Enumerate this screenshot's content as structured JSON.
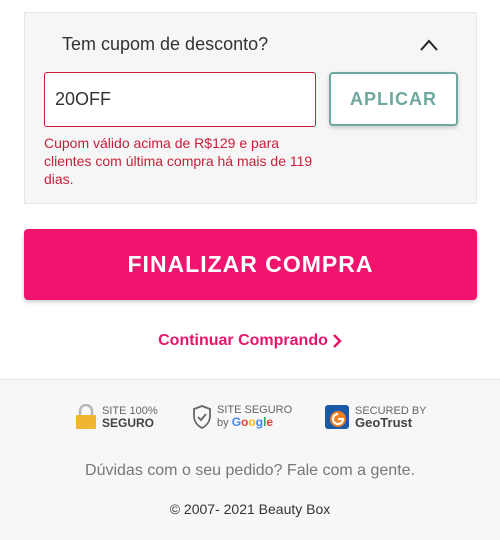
{
  "coupon": {
    "header": "Tem cupom de desconto?",
    "input_value": "20OFF",
    "apply_label": "APLICAR",
    "error": "Cupom válido acima de R$129 e para clientes com última compra há mais de 119 dias."
  },
  "checkout": {
    "label": "FINALIZAR COMPRA"
  },
  "continue": {
    "label": "Continuar Comprando"
  },
  "seals": {
    "site100": {
      "line1": "SITE 100%",
      "line2": "SEGURO"
    },
    "google": {
      "line1": "SITE SEGURO",
      "by": "by",
      "brand": "Google"
    },
    "geotrust": {
      "line1": "SECURED BY",
      "brand": "GeoTrust"
    }
  },
  "footer": {
    "help": "Dúvidas com o seu pedido? Fale com a gente.",
    "copyright": "© 2007- 2021 Beauty Box"
  },
  "colors": {
    "accent_pink": "#f0146e",
    "error_red": "#c81e3a",
    "teal": "#6ea89e"
  }
}
